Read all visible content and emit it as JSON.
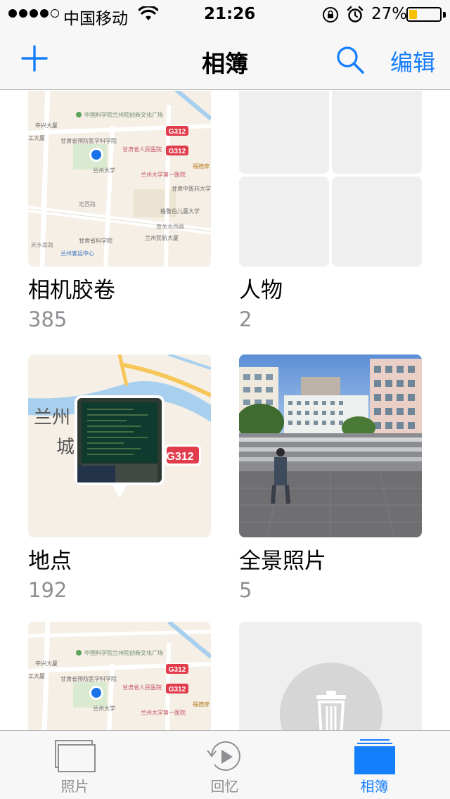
{
  "status_bar": {
    "carrier": "中国移动",
    "time": "21:26",
    "battery_percent": "27%",
    "battery_level": 0.27,
    "signal_bars_filled": 4,
    "signal_bars_total": 5
  },
  "nav": {
    "title": "相簿",
    "add_icon": "plus-icon",
    "search_icon": "search-icon",
    "edit_label": "编辑"
  },
  "albums": [
    {
      "title": "相机胶卷",
      "count": "385",
      "thumbnail": "map",
      "map_labels": [
        "中国科学院兰州院创新文化广场",
        "中兴大厦",
        "工大厦",
        "甘肃省预防医学科学院",
        "甘肃省人民医院",
        "兰州大学",
        "兰州大学第一医院",
        "福德摩",
        "甘肃中医药大学",
        "定西路",
        "格鲁伯儿童大学",
        "甘肃省科学院",
        "南关北西路",
        "兰州民航大厦",
        "天水南路",
        "兰州客运中心",
        "G312"
      ]
    },
    {
      "title": "人物",
      "count": "2",
      "thumbnail": "people-grid"
    },
    {
      "title": "地点",
      "count": "192",
      "thumbnail": "map-with-photo-pin",
      "map_labels": [
        "兰州",
        "城",
        "G312"
      ]
    },
    {
      "title": "全景照片",
      "count": "5",
      "thumbnail": "panorama-photo"
    },
    {
      "title": "",
      "count": "",
      "thumbnail": "map",
      "map_labels": [
        "中国科学院兰州院创新文化广场",
        "中兴大厦",
        "工大厦",
        "甘肃省预防医学科学院",
        "甘肃省人民医院",
        "兰州大学",
        "兰州大学第一医院",
        "福德摩",
        "G312"
      ]
    },
    {
      "title": "",
      "count": "",
      "thumbnail": "trash-icon"
    }
  ],
  "tabs": [
    {
      "label": "照片",
      "icon": "photos-icon",
      "active": false
    },
    {
      "label": "回忆",
      "icon": "memories-icon",
      "active": false
    },
    {
      "label": "相簿",
      "icon": "albums-icon",
      "active": true
    }
  ],
  "colors": {
    "accent": "#157efb",
    "count_gray": "#8e8e93",
    "map_bg": "#f5efe6",
    "map_water": "#a8d0ee",
    "map_road": "#f7c659",
    "highway_badge": "#e03c4b",
    "location_dot": "#1a73e8",
    "battery_fill": "#f8c000"
  }
}
